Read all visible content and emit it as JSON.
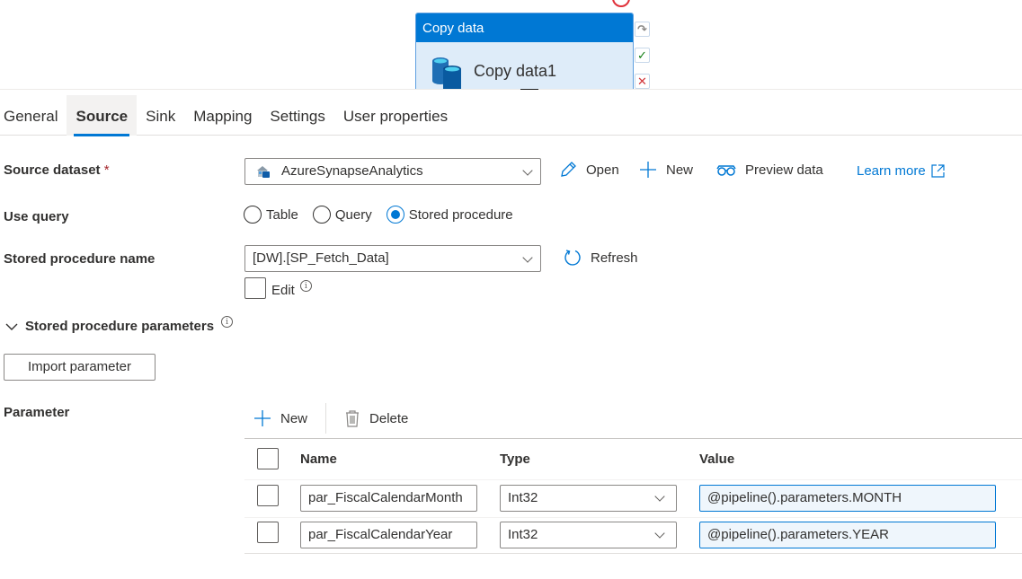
{
  "canvas": {
    "activity_type": "Copy data",
    "activity_name": "Copy data1",
    "side_icons": [
      "redo-icon",
      "success-check-icon",
      "failure-x-icon"
    ]
  },
  "tabs": [
    {
      "label": "General",
      "active": false
    },
    {
      "label": "Source",
      "active": true
    },
    {
      "label": "Sink",
      "active": false
    },
    {
      "label": "Mapping",
      "active": false
    },
    {
      "label": "Settings",
      "active": false
    },
    {
      "label": "User properties",
      "active": false
    }
  ],
  "source_dataset": {
    "label": "Source dataset",
    "required_marker": "*",
    "value": "AzureSynapseAnalytics",
    "actions": {
      "open": "Open",
      "new": "New",
      "preview": "Preview data",
      "learn_more": "Learn more"
    }
  },
  "use_query": {
    "label": "Use query",
    "options": [
      "Table",
      "Query",
      "Stored procedure"
    ],
    "selected": "Stored procedure"
  },
  "stored_procedure": {
    "label": "Stored procedure name",
    "value": "[DW].[SP_Fetch_Data]",
    "refresh": "Refresh",
    "edit_label": "Edit",
    "edit_checked": false
  },
  "sp_parameters": {
    "section_label": "Stored procedure parameters",
    "import_button": "Import parameter",
    "parameter_label": "Parameter",
    "toolbar": {
      "new": "New",
      "delete": "Delete"
    },
    "columns": [
      "Name",
      "Type",
      "Value"
    ],
    "rows": [
      {
        "name": "par_FiscalCalendarMonth",
        "type": "Int32",
        "value": "@pipeline().parameters.MONTH"
      },
      {
        "name": "par_FiscalCalendarYear",
        "type": "Int32",
        "value": "@pipeline().parameters.YEAR"
      }
    ]
  },
  "colors": {
    "accent": "#0078d4",
    "activity_body": "#deecf9",
    "required": "#a4262c",
    "success": "#107c10",
    "failure": "#d13438"
  }
}
